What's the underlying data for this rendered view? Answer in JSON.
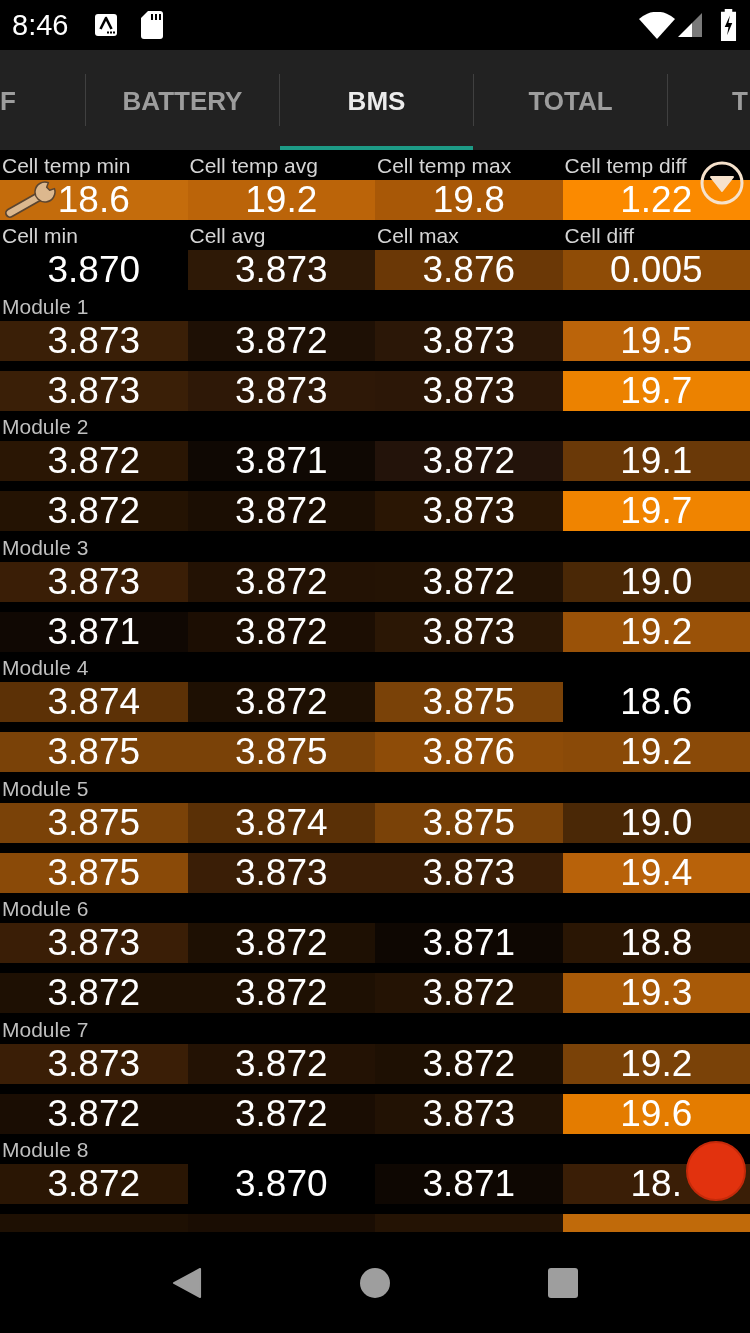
{
  "status_bar": {
    "time": "8:46"
  },
  "tabs": [
    {
      "label": "F",
      "selected": false
    },
    {
      "label": "BATTERY",
      "selected": false
    },
    {
      "label": "BMS",
      "selected": true
    },
    {
      "label": "TOTAL",
      "selected": false
    },
    {
      "label": "T",
      "selected": false
    }
  ],
  "summary": [
    {
      "cells": [
        {
          "label": "Cell temp min",
          "value": "18.6",
          "color": "#c46c0c"
        },
        {
          "label": "Cell temp avg",
          "value": "19.2",
          "color": "#bb6409"
        },
        {
          "label": "Cell temp max",
          "value": "19.8",
          "color": "#a85807"
        },
        {
          "label": "Cell temp diff",
          "value": "1.22",
          "color": "#fb8a00"
        }
      ]
    },
    {
      "cells": [
        {
          "label": "Cell min",
          "value": "3.870",
          "color": "#000000"
        },
        {
          "label": "Cell avg",
          "value": "3.873",
          "color": "#2e1906"
        },
        {
          "label": "Cell max",
          "value": "3.876",
          "color": "#6b3806"
        },
        {
          "label": "Cell diff",
          "value": "0.005",
          "color": "#8f4c06"
        }
      ]
    }
  ],
  "modules": [
    {
      "title": "Module 1",
      "rows": [
        {
          "cells": [
            {
              "value": "3.873",
              "color": "#3a1f07"
            },
            {
              "value": "3.872",
              "color": "#1e1005"
            },
            {
              "value": "3.873",
              "color": "#2b1707"
            },
            {
              "value": "19.5",
              "color": "#bb640a"
            }
          ]
        },
        {
          "cells": [
            {
              "value": "3.873",
              "color": "#3a1f07"
            },
            {
              "value": "3.873",
              "color": "#2e1807"
            },
            {
              "value": "3.873",
              "color": "#2c1707"
            },
            {
              "value": "19.7",
              "color": "#ec8200"
            }
          ]
        }
      ]
    },
    {
      "title": "Module 2",
      "rows": [
        {
          "cells": [
            {
              "value": "3.872",
              "color": "#2a1604"
            },
            {
              "value": "3.871",
              "color": "#0f0803"
            },
            {
              "value": "3.872",
              "color": "#23130a"
            },
            {
              "value": "19.1",
              "color": "#6a3908"
            }
          ]
        },
        {
          "cells": [
            {
              "value": "3.872",
              "color": "#241303"
            },
            {
              "value": "3.872",
              "color": "#1b0e03"
            },
            {
              "value": "3.873",
              "color": "#2a1604"
            },
            {
              "value": "19.7",
              "color": "#f08400"
            }
          ]
        }
      ]
    },
    {
      "title": "Module 3",
      "rows": [
        {
          "cells": [
            {
              "value": "3.873",
              "color": "#3a1e06"
            },
            {
              "value": "3.872",
              "color": "#231204"
            },
            {
              "value": "3.872",
              "color": "#241304"
            },
            {
              "value": "19.0",
              "color": "#4a2806"
            }
          ]
        },
        {
          "cells": [
            {
              "value": "3.871",
              "color": "#100803"
            },
            {
              "value": "3.872",
              "color": "#1c0e03"
            },
            {
              "value": "3.873",
              "color": "#2b1705"
            },
            {
              "value": "19.2",
              "color": "#9a5208"
            }
          ]
        }
      ]
    },
    {
      "title": "Module 4",
      "rows": [
        {
          "cells": [
            {
              "value": "3.874",
              "color": "#5c3106"
            },
            {
              "value": "3.872",
              "color": "#1e1003"
            },
            {
              "value": "3.875",
              "color": "#7a4208"
            },
            {
              "value": "18.6",
              "color": "#000000"
            }
          ]
        },
        {
          "cells": [
            {
              "value": "3.875",
              "color": "#7a4208"
            },
            {
              "value": "3.875",
              "color": "#7a4208"
            },
            {
              "value": "3.876",
              "color": "#8e4c08"
            },
            {
              "value": "19.2",
              "color": "#8a4a08"
            }
          ]
        }
      ]
    },
    {
      "title": "Module 5",
      "rows": [
        {
          "cells": [
            {
              "value": "3.875",
              "color": "#7a4208"
            },
            {
              "value": "3.874",
              "color": "#5a3006"
            },
            {
              "value": "3.875",
              "color": "#7a4208"
            },
            {
              "value": "19.0",
              "color": "#4a2806"
            }
          ]
        },
        {
          "cells": [
            {
              "value": "3.875",
              "color": "#8a4a08"
            },
            {
              "value": "3.873",
              "color": "#3a1e06"
            },
            {
              "value": "3.873",
              "color": "#3a1e06"
            },
            {
              "value": "19.4",
              "color": "#b8620a"
            }
          ]
        }
      ]
    },
    {
      "title": "Module 6",
      "rows": [
        {
          "cells": [
            {
              "value": "3.873",
              "color": "#3a1e06"
            },
            {
              "value": "3.872",
              "color": "#1e1003"
            },
            {
              "value": "3.871",
              "color": "#0e0702"
            },
            {
              "value": "18.8",
              "color": "#2a1604"
            }
          ]
        },
        {
          "cells": [
            {
              "value": "3.872",
              "color": "#1e1003"
            },
            {
              "value": "3.872",
              "color": "#1e1003"
            },
            {
              "value": "3.872",
              "color": "#241304"
            },
            {
              "value": "19.3",
              "color": "#a85a08"
            }
          ]
        }
      ]
    },
    {
      "title": "Module 7",
      "rows": [
        {
          "cells": [
            {
              "value": "3.873",
              "color": "#3a1e06"
            },
            {
              "value": "3.872",
              "color": "#231204"
            },
            {
              "value": "3.872",
              "color": "#1e1003"
            },
            {
              "value": "19.2",
              "color": "#7a4208"
            }
          ]
        },
        {
          "cells": [
            {
              "value": "3.872",
              "color": "#1a0d03"
            },
            {
              "value": "3.872",
              "color": "#1a0d03"
            },
            {
              "value": "3.873",
              "color": "#221204"
            },
            {
              "value": "19.6",
              "color": "#e47c00"
            }
          ]
        }
      ]
    },
    {
      "title": "Module 8",
      "rows": [
        {
          "cells": [
            {
              "value": "3.872",
              "color": "#2a1604"
            },
            {
              "value": "3.870",
              "color": "#000000"
            },
            {
              "value": "3.871",
              "color": "#0e0702"
            },
            {
              "value": "18.",
              "color": "#3a1e06"
            }
          ]
        },
        {
          "cells": [
            {
              "color": "#1e1003"
            },
            {
              "color": "#1a0d03"
            },
            {
              "color": "#241304"
            },
            {
              "color": "#c06a0a"
            }
          ]
        }
      ]
    }
  ]
}
